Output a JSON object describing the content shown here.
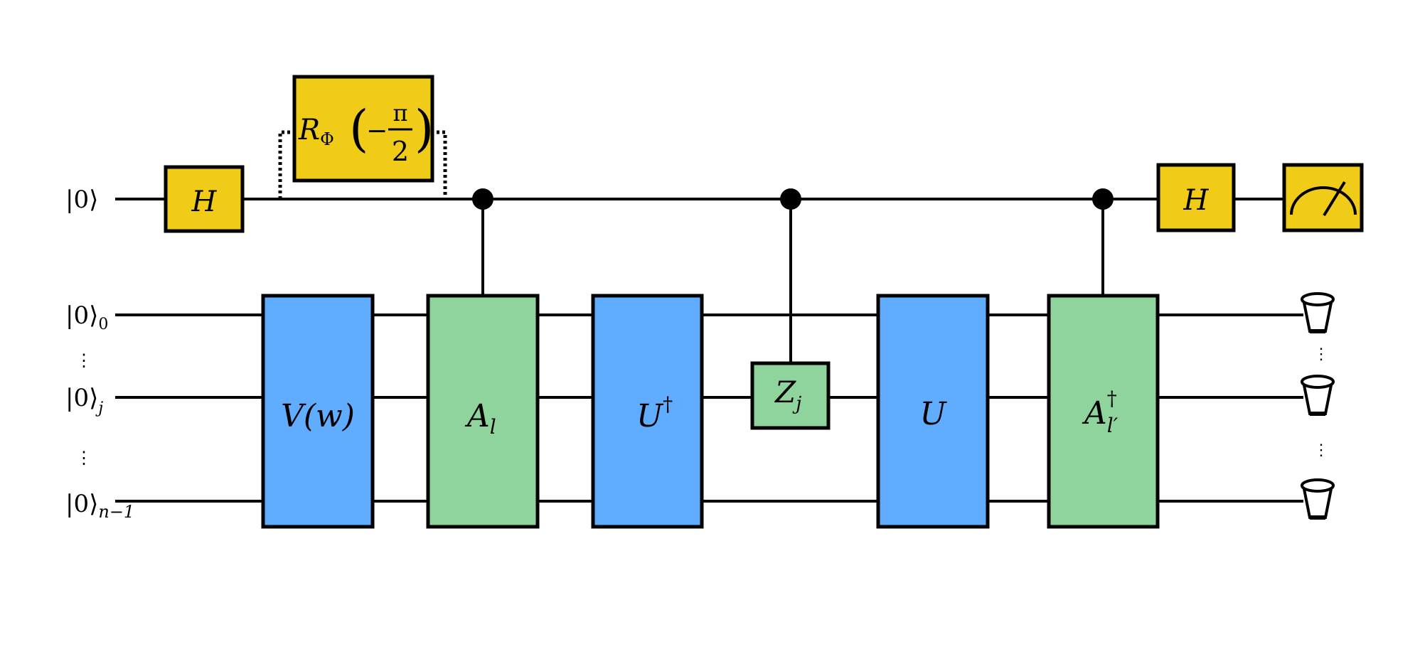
{
  "colors": {
    "single_gate": "#F0CB17",
    "unitary_gate": "#60ADFF",
    "operator_gate": "#8FD49D",
    "wire": "#000000",
    "background": "#FFFFFF"
  },
  "qubits": {
    "ancilla": {
      "ket": "|0⟩",
      "subscript": ""
    },
    "register": [
      {
        "ket": "|0⟩",
        "subscript": "0"
      },
      {
        "ket": "|0⟩",
        "subscript": "j"
      },
      {
        "ket": "|0⟩",
        "subscript": "n−1"
      }
    ],
    "ellipsis": "⋮"
  },
  "gates": {
    "h_first": {
      "label": "H"
    },
    "phase": {
      "symbol": "R",
      "subscript": "Φ",
      "arg_sign": "−",
      "arg_num": "π",
      "arg_den": "2",
      "open_paren": "(",
      "close_paren": ")",
      "dotted_bracket": true
    },
    "v": {
      "label": "V(w)"
    },
    "a_l": {
      "label": "A",
      "subscript": "l"
    },
    "u_dagger": {
      "label": "U",
      "superscript": "†"
    },
    "z_j": {
      "label": "Z",
      "subscript": "j"
    },
    "u": {
      "label": "U"
    },
    "a_dagger_lprime": {
      "label": "A",
      "superscript": "†",
      "subscript": "l′"
    },
    "h_last": {
      "label": "H"
    },
    "measure": {
      "icon": "meter-icon"
    }
  },
  "controls": [
    {
      "target": "A_l",
      "control_qubit": "ancilla"
    },
    {
      "target": "Z_j",
      "control_qubit": "ancilla"
    },
    {
      "target": "A†_l′",
      "control_qubit": "ancilla"
    }
  ],
  "discards": {
    "count": 3,
    "icon": "trash-bucket-icon"
  }
}
